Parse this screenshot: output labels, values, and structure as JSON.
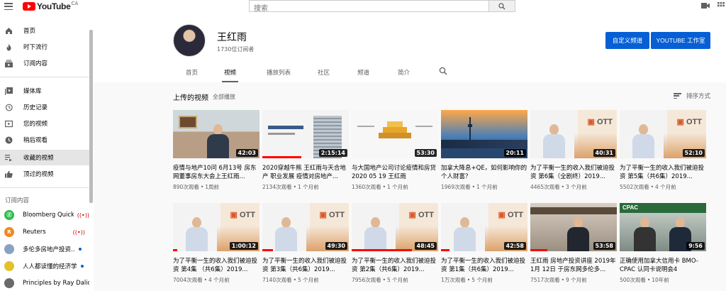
{
  "app": {
    "logo_text": "YouTube",
    "region": "CA"
  },
  "search": {
    "placeholder": "搜索"
  },
  "sidebar": {
    "items": [
      {
        "label": "首页",
        "icon": "home-icon"
      },
      {
        "label": "时下流行",
        "icon": "trending-icon"
      },
      {
        "label": "订阅内容",
        "icon": "subscriptions-icon"
      },
      {
        "label": "媒体库",
        "icon": "library-icon"
      },
      {
        "label": "历史记录",
        "icon": "history-icon"
      },
      {
        "label": "您的视频",
        "icon": "your-videos-icon"
      },
      {
        "label": "稍后观看",
        "icon": "watch-later-icon"
      },
      {
        "label": "收藏的视频",
        "icon": "playlist-icon"
      },
      {
        "label": "顶过的视频",
        "icon": "thumbs-up-icon"
      }
    ],
    "subscriptions_title": "订阅内容",
    "subscriptions": [
      {
        "name": "Bloomberg QuickT...",
        "indicator": "live",
        "avatar_color": "#2bbf4a",
        "avatar_text": "Ⓧ"
      },
      {
        "name": "Reuters",
        "indicator": "live",
        "avatar_color": "#f08a24",
        "avatar_text": "R"
      },
      {
        "name": "多伦多房地产投资...",
        "indicator": "new",
        "avatar_color": "#8aa2c0",
        "avatar_text": ""
      },
      {
        "name": "人人都读懂的经济学",
        "indicator": "new",
        "avatar_color": "#e2c22a",
        "avatar_text": ""
      },
      {
        "name": "Principles by Ray Dalio",
        "indicator": "",
        "avatar_color": "#6a6a6a",
        "avatar_text": ""
      }
    ]
  },
  "channel": {
    "name": "王红雨",
    "subscribers": "1730位订阅者",
    "customize_label": "自定义频道",
    "studio_label": "YOUTUBE 工作室",
    "tabs": [
      "首页",
      "视频",
      "播放列表",
      "社区",
      "频道",
      "简介"
    ],
    "active_tab": "视频"
  },
  "section": {
    "title": "上传的视频",
    "play_all": "全部播放",
    "sort_label": "排序方式"
  },
  "videos": [
    {
      "title": "疫情与地产10问 6月13号 房东网董事房东大会上王红雨...",
      "views": "890次观看",
      "age": "1周前",
      "duration": "42:03",
      "thumb": "room",
      "progress": 0
    },
    {
      "title": "2020穿越牛熊 王红雨与天合地产 职业发展 疫情对房地产...",
      "views": "2134次观看",
      "age": "1 个月前",
      "duration": "2:15:14",
      "thumb": "slide",
      "progress": 0.45
    },
    {
      "title": "与大国地产公司讨论疫情和房贷 2020 05 19 王红雨",
      "views": "1360次观看",
      "age": "1 个月前",
      "duration": "53:30",
      "thumb": "slide2",
      "progress": 0
    },
    {
      "title": "加拿大降息+QE，如何影响你的个人财富？",
      "views": "1969次观看",
      "age": "1 个月前",
      "duration": "20:11",
      "thumb": "city",
      "progress": 0
    },
    {
      "title": "为了平衡一生的收入我们被迫投资 第6集（全剧终）2019...",
      "views": "4465次观看",
      "age": "3 个月前",
      "duration": "40:31",
      "thumb": "ott",
      "progress": 0
    },
    {
      "title": "为了平衡一生的收入我们被迫投资 第5集（共6集）2019...",
      "views": "5502次观看",
      "age": "4 个月前",
      "duration": "52:10",
      "thumb": "ott",
      "progress": 0
    },
    {
      "title": "为了平衡一生的收入我们被迫投资 第4集 （共6集）2019...",
      "views": "7004次观看",
      "age": "4 个月前",
      "duration": "1:00:12",
      "thumb": "ott",
      "progress": 0.05
    },
    {
      "title": "为了平衡一生的收入我们被迫投资 第3集（共6集）2019...",
      "views": "7140次观看",
      "age": "5 个月前",
      "duration": "49:30",
      "thumb": "ott",
      "progress": 0.12
    },
    {
      "title": "为了平衡一生的收入我们被迫投资 第2集（共6集）2019...",
      "views": "7956次观看",
      "age": "5 个月前",
      "duration": "48:45",
      "thumb": "ott",
      "progress": 0.7
    },
    {
      "title": "为了平衡一生的收入我们被迫投资 第1集（共6集）2019...",
      "views": "1万次观看",
      "age": "5 个月前",
      "duration": "42:58",
      "thumb": "ott",
      "progress": 0.1
    },
    {
      "title": "王红雨 房地产投资讲座 2019年1月 12日 于房东网多伦多...",
      "views": "7517次观看",
      "age": "9 个月前",
      "duration": "53:58",
      "thumb": "stage",
      "progress": 0.2
    },
    {
      "title": "正确使用加拿大信用卡 BMO-CPAC 认同卡说明会4",
      "views": "500次观看",
      "age": "10年前",
      "duration": "9:56",
      "thumb": "cpac",
      "progress": 0
    }
  ]
}
